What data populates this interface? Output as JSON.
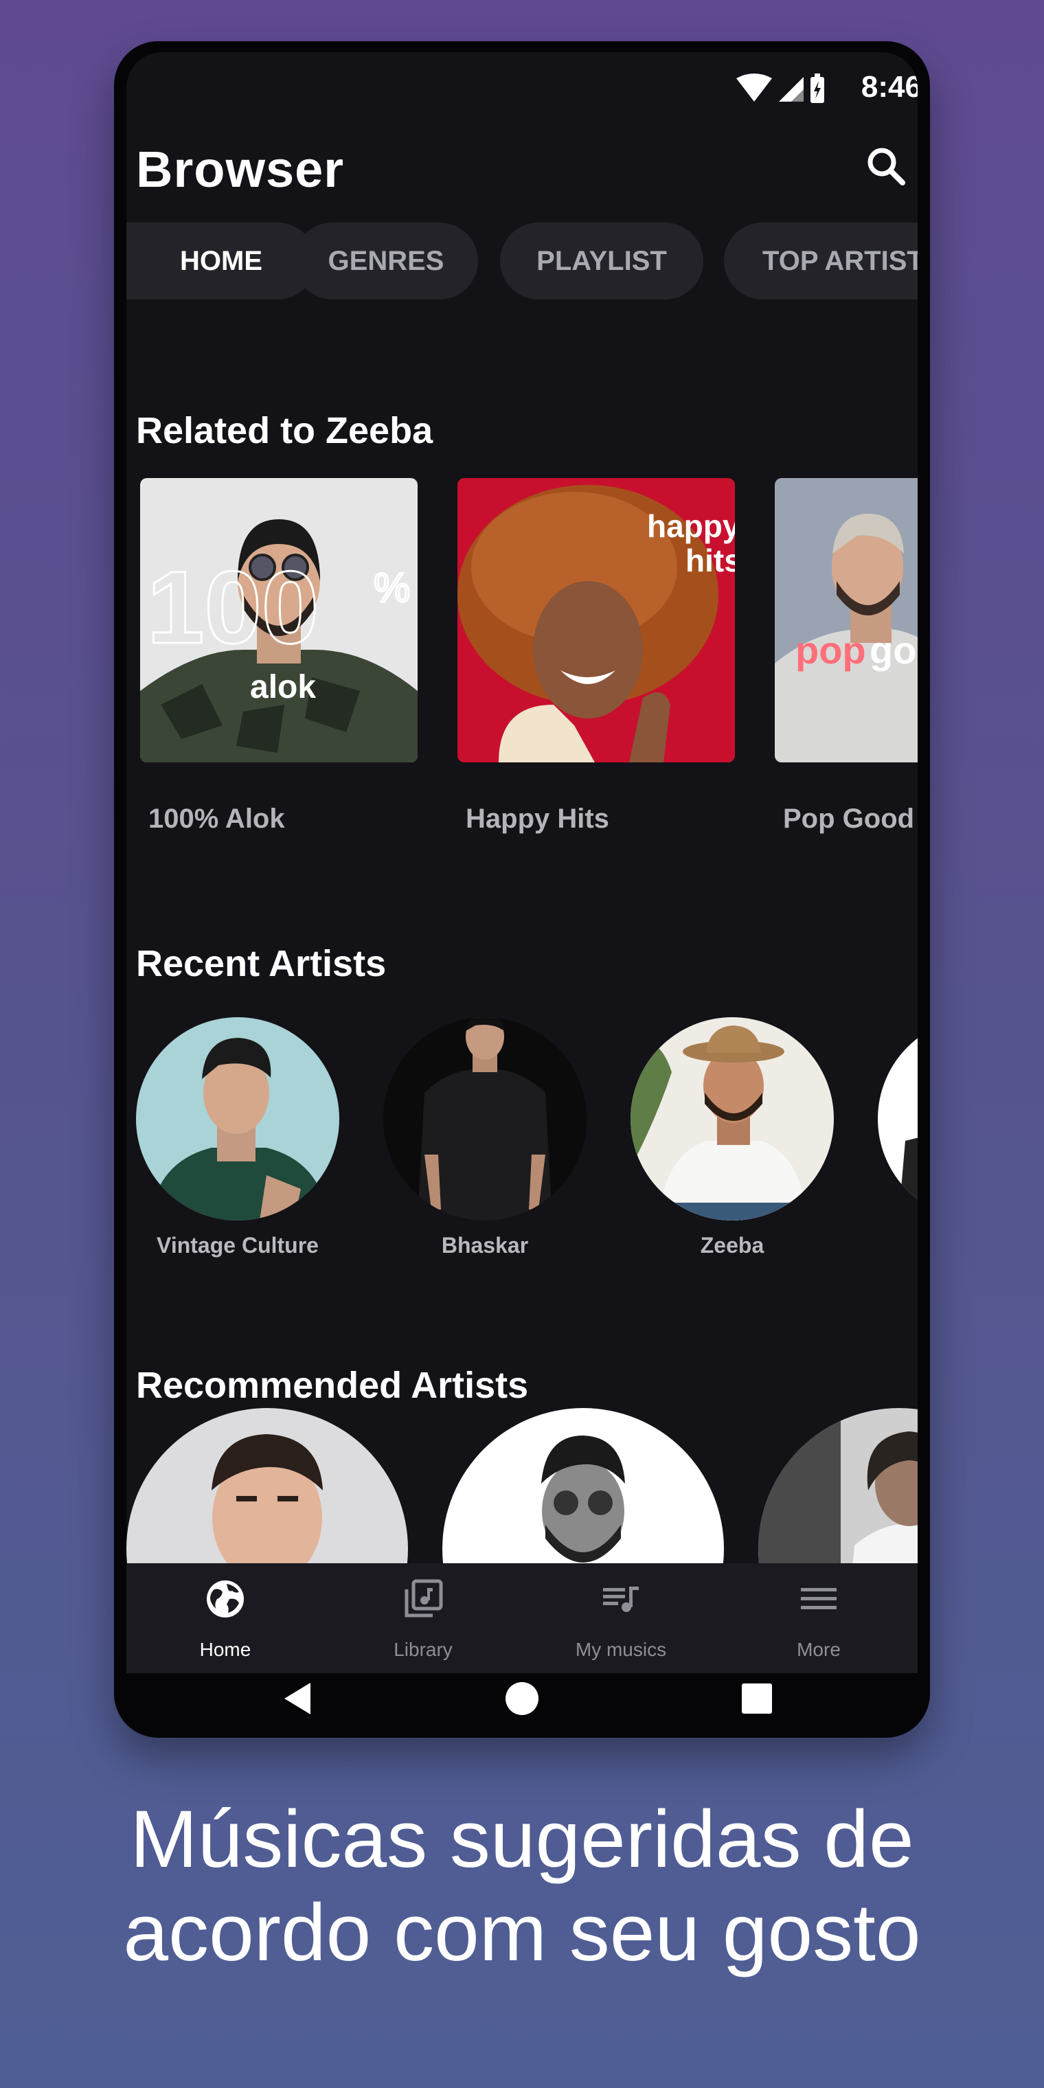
{
  "status_bar": {
    "time": "8:46"
  },
  "app_bar": {
    "title": "Browser",
    "search_icon": "search-icon"
  },
  "tabs": [
    {
      "label": "HOME",
      "active": true
    },
    {
      "label": "GENRES",
      "active": false
    },
    {
      "label": "PLAYLIST",
      "active": false
    },
    {
      "label": "TOP ARTISTS",
      "active": false
    }
  ],
  "sections": {
    "related": {
      "title": "Related to Zeeba",
      "albums": [
        {
          "title": "100% Alok",
          "cover_text_big": "100",
          "cover_text_pct": "%",
          "cover_text_name": "alok"
        },
        {
          "title": "Happy Hits",
          "cover_text_line1": "happy",
          "cover_text_line2": "hits"
        },
        {
          "title": "Pop Good Vibes",
          "cover_text_line1": "pop",
          "cover_text_line2": "good"
        }
      ]
    },
    "recent": {
      "title": "Recent Artists",
      "artists": [
        {
          "name": "Vintage Culture"
        },
        {
          "name": "Bhaskar"
        },
        {
          "name": "Zeeba"
        }
      ]
    },
    "recommended": {
      "title": "Recommended Artists"
    }
  },
  "bottom_nav": [
    {
      "label": "Home",
      "icon": "globe-icon",
      "active": true
    },
    {
      "label": "Library",
      "icon": "library-music-icon",
      "active": false
    },
    {
      "label": "My musics",
      "icon": "queue-music-icon",
      "active": false
    },
    {
      "label": "More",
      "icon": "menu-icon",
      "active": false
    }
  ],
  "caption": {
    "line1": "Músicas sugeridas de",
    "line2": "acordo com seu gosto"
  },
  "colors": {
    "background_top": "#5f4a91",
    "background_bottom": "#4f5f95",
    "screen": "#121217",
    "chip": "#232329",
    "bottom_nav": "#1a1a20"
  }
}
